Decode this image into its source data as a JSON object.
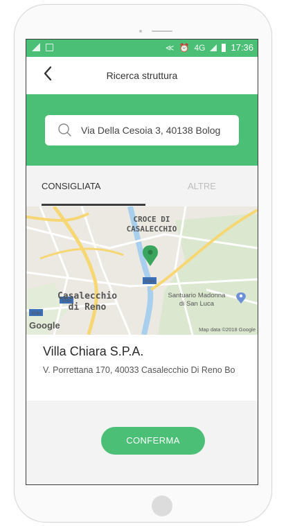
{
  "status_bar": {
    "time": "17:36",
    "network_label": "4G"
  },
  "header": {
    "title": "Ricerca struttura",
    "back_icon": "chevron-left-icon"
  },
  "search": {
    "value": "Via Della Cesoia 3, 40138 Bolog",
    "icon": "search-icon"
  },
  "tabs": [
    {
      "label": "CONSIGLIATA",
      "active": true
    },
    {
      "label": "ALTRE",
      "active": false
    }
  ],
  "map": {
    "labels": {
      "district_line1": "CROCE DI",
      "district_line2": "CASALECCHIO",
      "town_line1": "Casalecchio",
      "town_line2": "di Reno",
      "poi_line1": "Santuario Madonna",
      "poi_line2": "di San Luca",
      "road_shield_1": "SS64",
      "road_shield_2": "SS64",
      "road_shield_3": "SS64",
      "google_logo": "Google",
      "attribution": "Map data ©2018 Google"
    },
    "marker_color": "#3aa55c"
  },
  "result": {
    "name": "Villa Chiara S.P.A.",
    "address": "V. Porrettana 170, 40033 Casalecchio Di Reno Bo"
  },
  "actions": {
    "confirm_label": "CONFERMA"
  },
  "colors": {
    "accent": "#4cbf77",
    "text_primary": "#2a2a2a",
    "tab_inactive": "#bdbdbd"
  }
}
